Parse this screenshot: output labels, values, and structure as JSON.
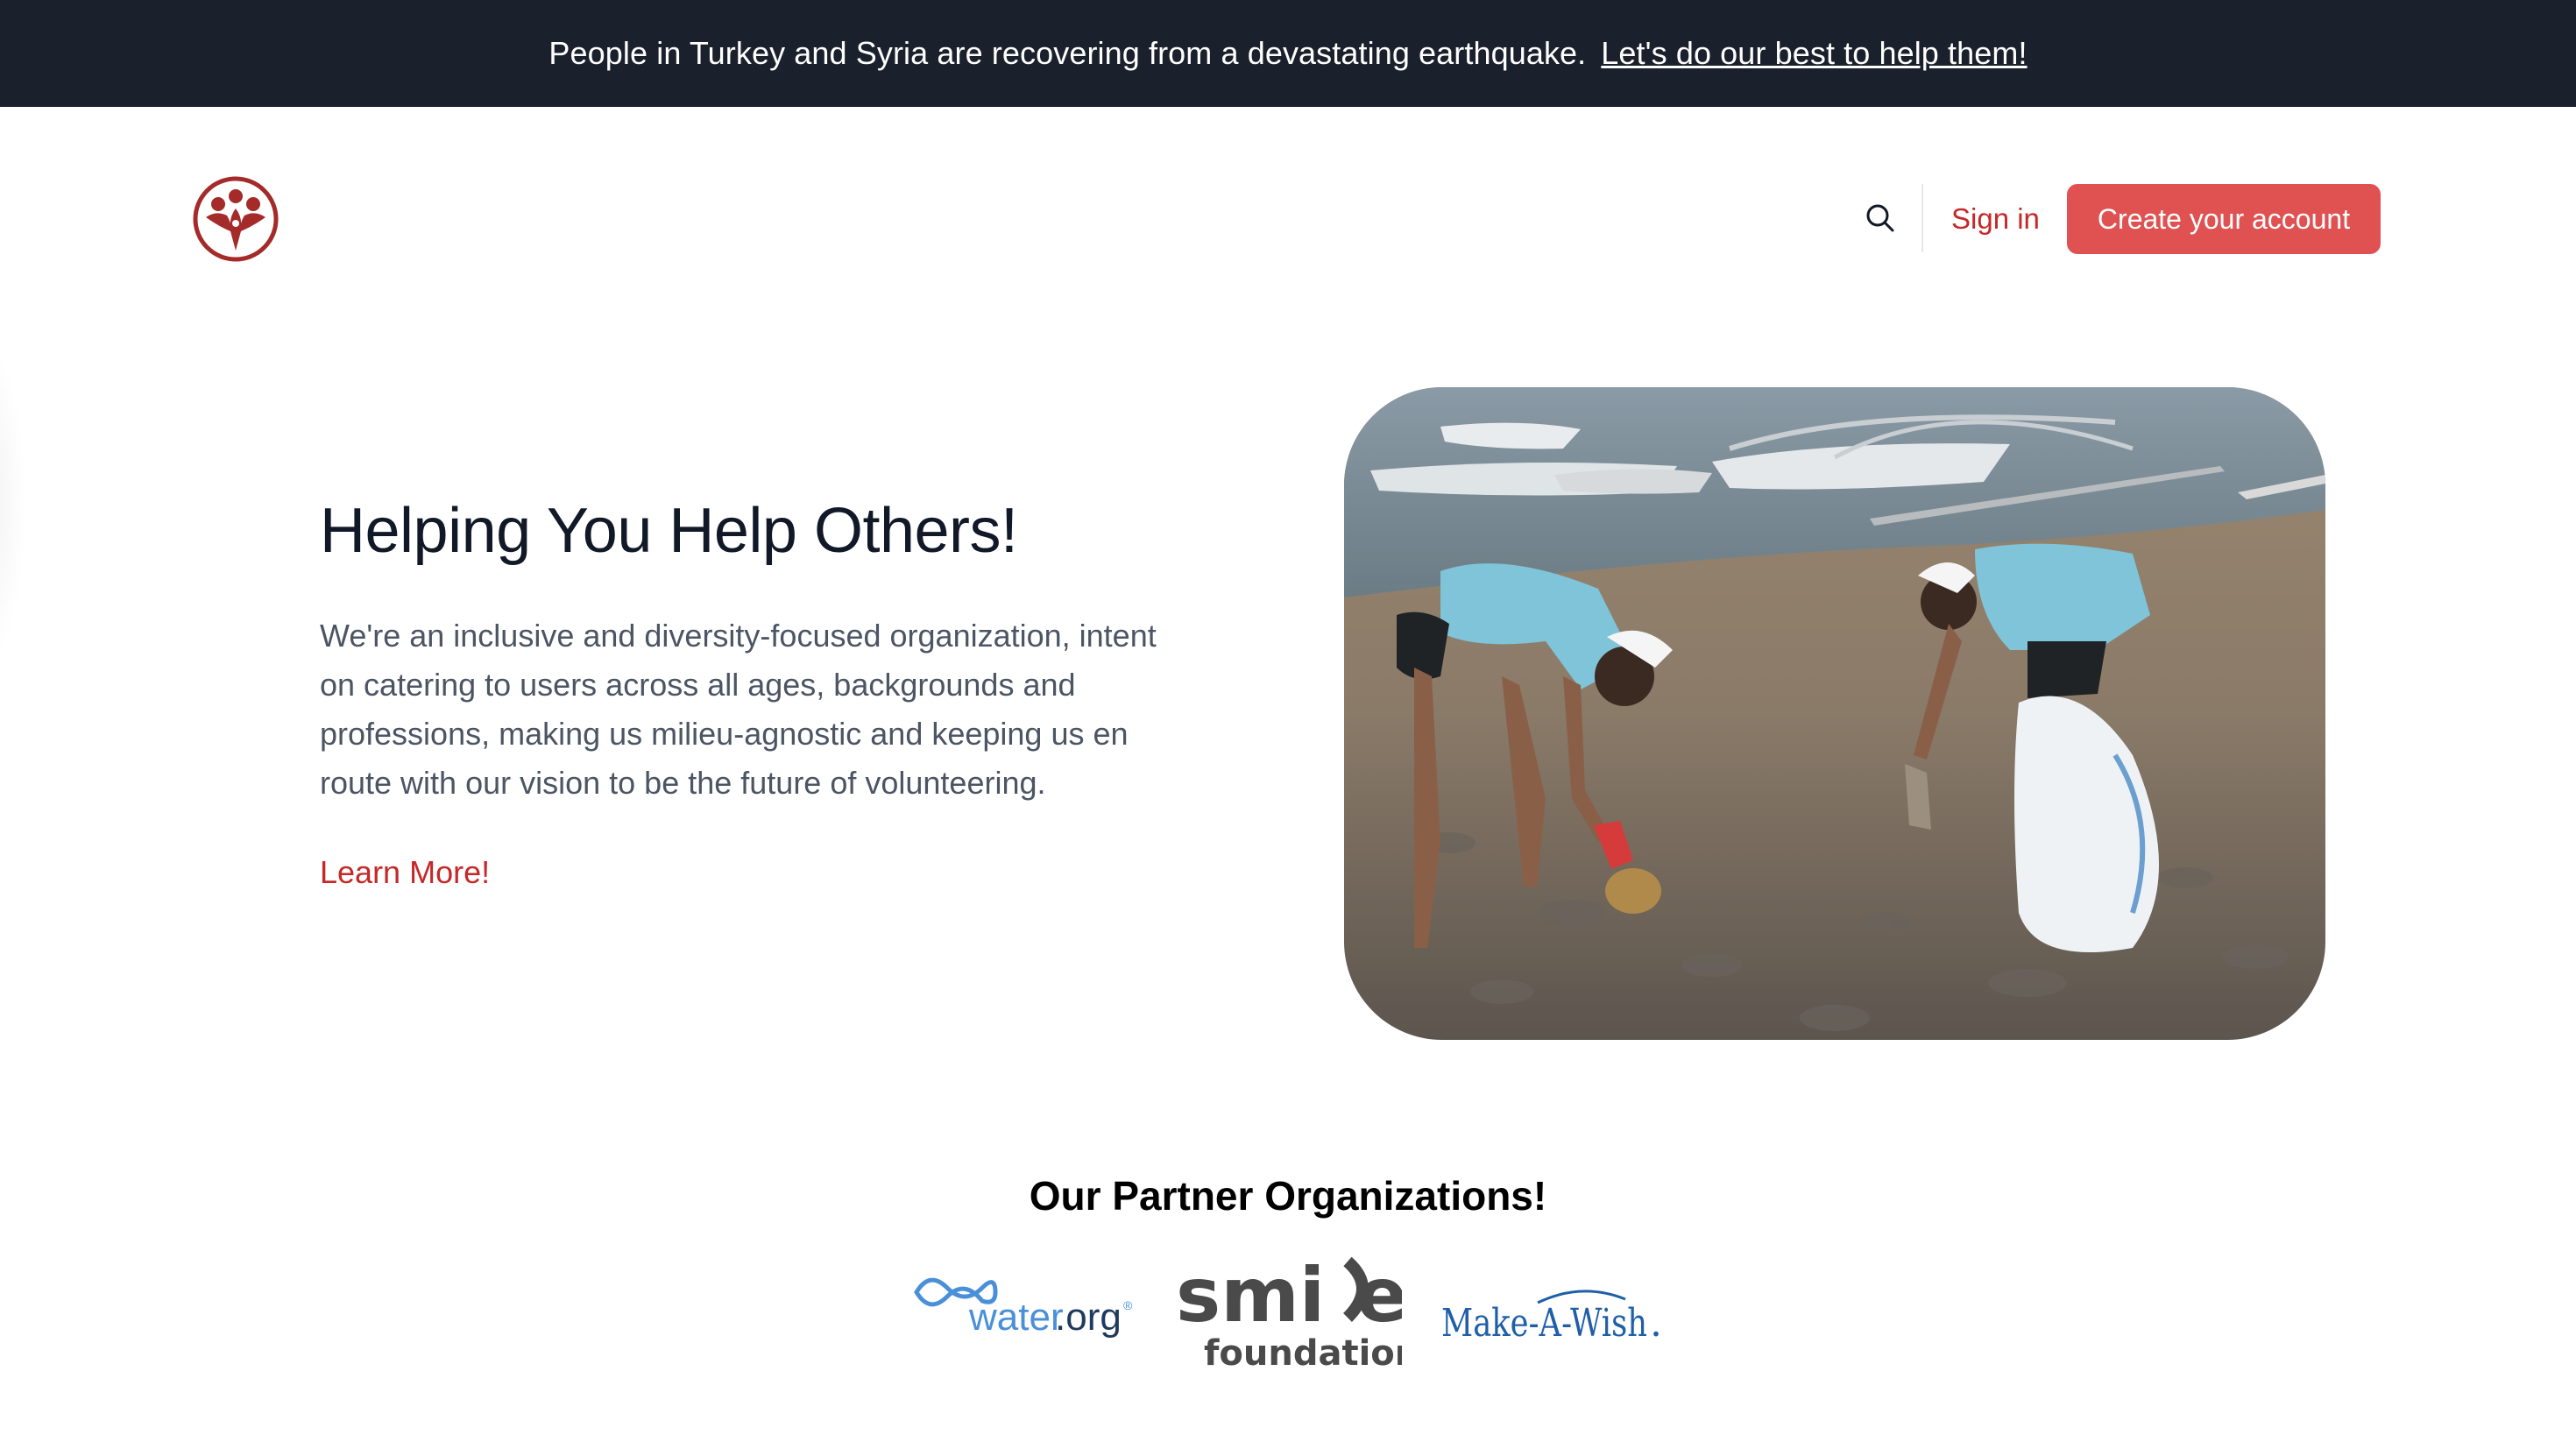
{
  "banner": {
    "message": "People in Turkey and Syria are recovering from a devastating earthquake.",
    "link_label": "Let's do our best to help them!"
  },
  "header": {
    "logo_icon": "people-hands-logo-icon",
    "search_icon": "search-icon",
    "signin_label": "Sign in",
    "create_account_label": "Create your account"
  },
  "hero": {
    "title": "Helping You Help Others!",
    "description": "We're an inclusive and diversity-focused organization, intent on catering to users across all ages, backgrounds and professions, making us milieu-agnostic and keeping us en route with our vision to be the future of volunteering.",
    "learn_more_label": "Learn More!",
    "image_subject": "volunteers-cleaning-beach-photo"
  },
  "partners": {
    "title": "Our Partner Organizations!",
    "logos": [
      {
        "text_main": "water",
        "text_suffix": ".org",
        "mark": "®"
      },
      {
        "text_main": "smi",
        "text_tail": "e",
        "subtext": "foundation"
      },
      {
        "text_main": "Make-A-Wish",
        "mark": "."
      }
    ]
  },
  "colors": {
    "banner_bg": "#1a202c",
    "accent_red": "#c62828",
    "button_red": "#e05252",
    "logo_red": "#a52a2a",
    "body_text": "#4b5563",
    "water_blue": "#4a90d9",
    "wish_blue": "#1f5fa8",
    "smile_gray": "#4a4a4a"
  }
}
